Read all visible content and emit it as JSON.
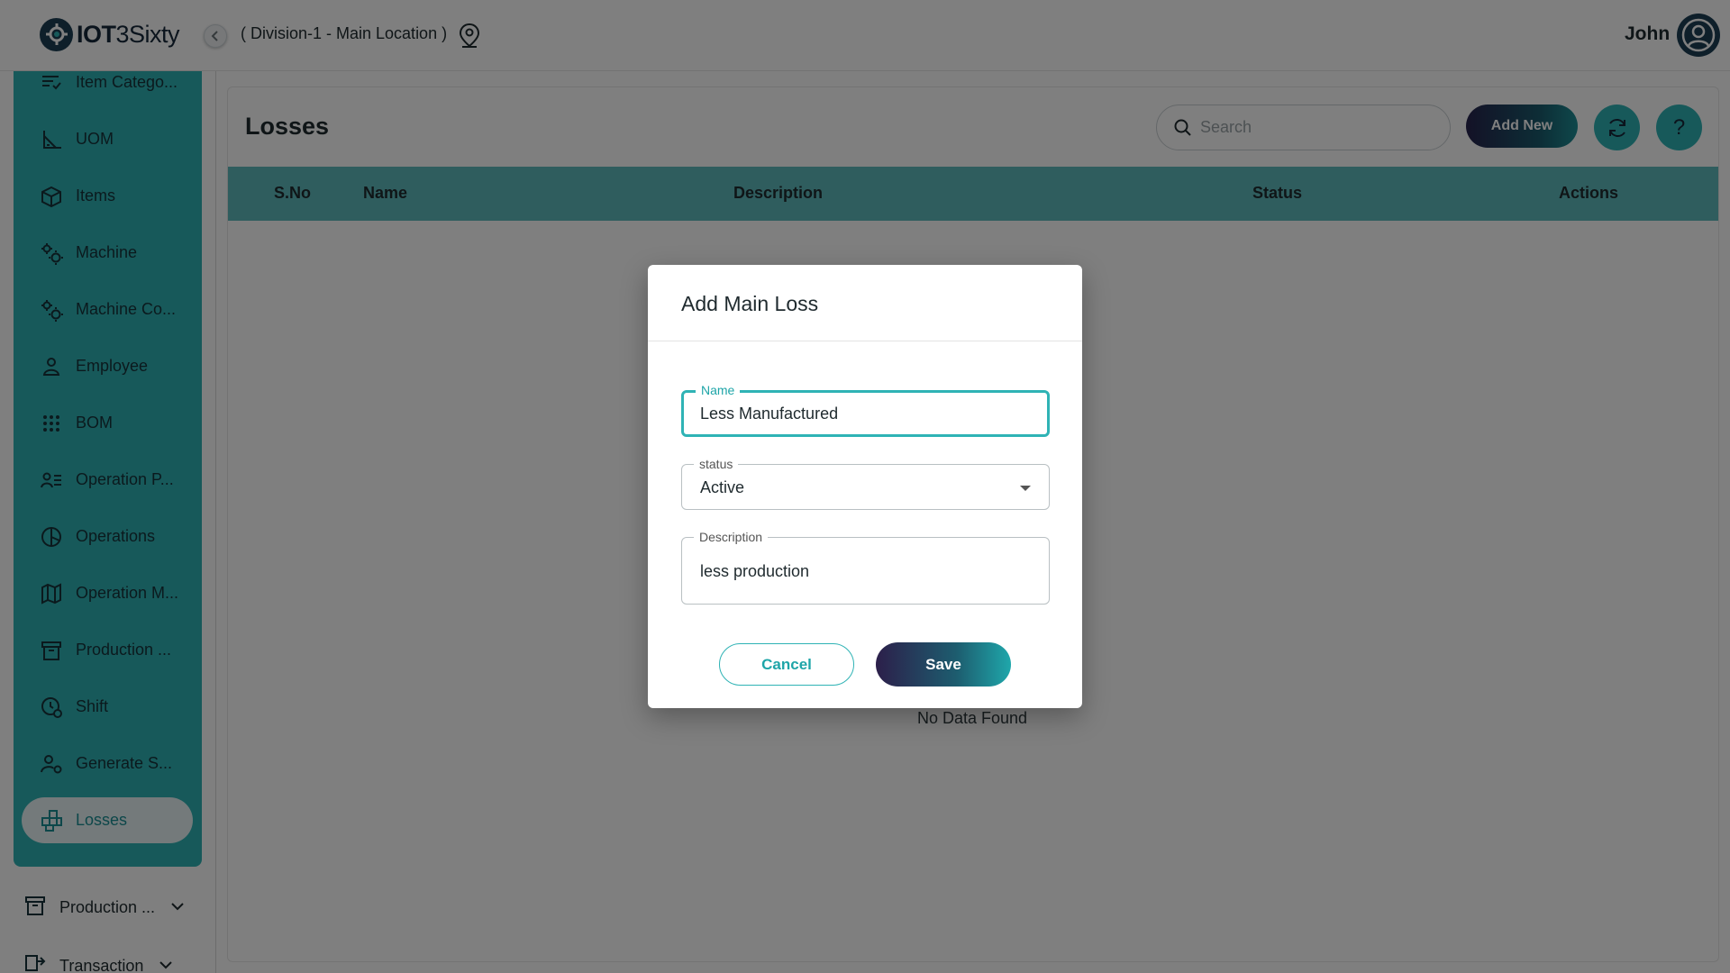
{
  "app": {
    "logo_bold": "IOT",
    "logo_light": "3Sixty",
    "location": "( Division-1 - Main Location )",
    "user_name": "John"
  },
  "sidebar": {
    "items": [
      {
        "label": "Item Catego...",
        "icon": "list-filter-icon"
      },
      {
        "label": "UOM",
        "icon": "ruler-angle-icon"
      },
      {
        "label": "Items",
        "icon": "cube-icon"
      },
      {
        "label": "Machine",
        "icon": "gears-icon"
      },
      {
        "label": "Machine Co...",
        "icon": "gears-icon"
      },
      {
        "label": "Employee",
        "icon": "person-icon"
      },
      {
        "label": "BOM",
        "icon": "grid-dots-icon"
      },
      {
        "label": "Operation P...",
        "icon": "person-list-icon"
      },
      {
        "label": "Operations",
        "icon": "pie-icon"
      },
      {
        "label": "Operation M...",
        "icon": "map-icon"
      },
      {
        "label": "Production ...",
        "icon": "archive-icon"
      },
      {
        "label": "Shift",
        "icon": "clock-person-icon"
      },
      {
        "label": "Generate S...",
        "icon": "person-gear-icon"
      },
      {
        "label": "Losses",
        "icon": "blocks-icon",
        "active": true
      }
    ],
    "groups": [
      {
        "label": "Production ...",
        "icon": "archive-icon"
      },
      {
        "label": "Transaction",
        "icon": "transaction-icon"
      }
    ]
  },
  "page": {
    "title": "Losses",
    "search_placeholder": "Search",
    "add_new_label": "Add New",
    "help_label": "?",
    "no_data": "No Data Found"
  },
  "table": {
    "columns": [
      "S.No",
      "Name",
      "Description",
      "Status",
      "Actions"
    ]
  },
  "modal": {
    "title": "Add Main Loss",
    "name_label": "Name",
    "name_value": "Less Manufactured",
    "status_label": "status",
    "status_value": "Active",
    "description_label": "Description",
    "description_value": "less production",
    "cancel_label": "Cancel",
    "save_label": "Save"
  },
  "colors": {
    "accent": "#2fb3b5",
    "header_dark": "#1d3e55",
    "table_head": "#5fbbbd"
  }
}
